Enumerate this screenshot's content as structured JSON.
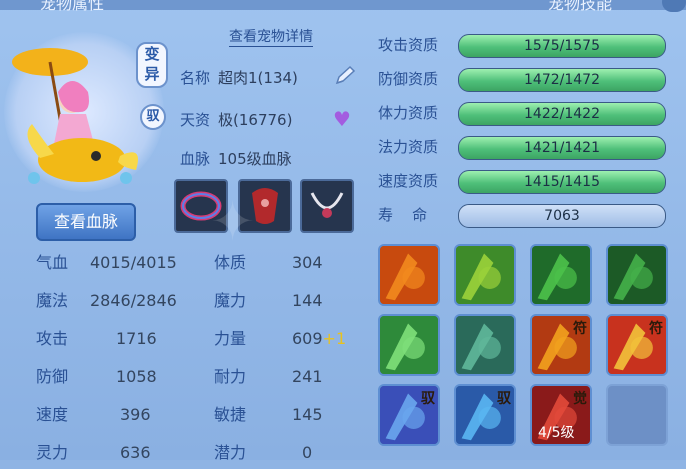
{
  "header": {
    "left_title": "宠物属性",
    "right_title": "宠物技能"
  },
  "pet": {
    "variant_tag": "变异",
    "tame_tag": "驭",
    "blood_button": "查看血脉",
    "detail_link": "查看宠物详情",
    "name_label": "名称",
    "name_value": "超肉1(134)",
    "talent_label": "天资",
    "talent_value": "极(16776)",
    "bloodline_label": "血脉",
    "bloodline_value": "105级血脉"
  },
  "stats": [
    {
      "k": "气血",
      "v": "4015/4015"
    },
    {
      "k": "魔法",
      "v": "2846/2846"
    },
    {
      "k": "攻击",
      "v": "1716"
    },
    {
      "k": "防御",
      "v": "1058"
    },
    {
      "k": "速度",
      "v": "396"
    },
    {
      "k": "灵力",
      "v": "636"
    }
  ],
  "attrs": [
    {
      "k": "体质",
      "v": "304",
      "plus": ""
    },
    {
      "k": "魔力",
      "v": "144",
      "plus": ""
    },
    {
      "k": "力量",
      "v": "609",
      "plus": "+1"
    },
    {
      "k": "耐力",
      "v": "241",
      "plus": ""
    },
    {
      "k": "敏捷",
      "v": "145",
      "plus": ""
    },
    {
      "k": "潜力",
      "v": "0",
      "plus": ""
    }
  ],
  "aptitudes": [
    {
      "k": "攻击资质",
      "v": "1575/1575",
      "fill": 1.0
    },
    {
      "k": "防御资质",
      "v": "1472/1472",
      "fill": 1.0
    },
    {
      "k": "体力资质",
      "v": "1422/1422",
      "fill": 1.0
    },
    {
      "k": "法力资质",
      "v": "1421/1421",
      "fill": 1.0
    },
    {
      "k": "速度资质",
      "v": "1415/1415",
      "fill": 1.0
    }
  ],
  "life": {
    "k": "寿    命",
    "v": "7063"
  },
  "skills": [
    {
      "name": "sword-strike-icon",
      "mark": "",
      "lvl": ""
    },
    {
      "name": "shield-emblem-icon",
      "mark": "",
      "lvl": ""
    },
    {
      "name": "bat-shadow-icon",
      "mark": "",
      "lvl": ""
    },
    {
      "name": "horse-silhouette-icon",
      "mark": "",
      "lvl": ""
    },
    {
      "name": "heart-icon",
      "mark": "",
      "lvl": ""
    },
    {
      "name": "swirl-shield-icon",
      "mark": "",
      "lvl": ""
    },
    {
      "name": "red-warrior-icon",
      "mark": "符",
      "lvl": ""
    },
    {
      "name": "sword-burst-icon",
      "mark": "符",
      "lvl": ""
    },
    {
      "name": "purple-fist-icon",
      "mark": "驭",
      "lvl": ""
    },
    {
      "name": "ice-claw-icon",
      "mark": "驭",
      "lvl": ""
    },
    {
      "name": "awaken-slash-icon",
      "mark": "觉",
      "lvl": "4/5级"
    },
    {
      "name": "empty-skill-slot",
      "mark": "",
      "lvl": ""
    }
  ],
  "colors": {
    "bar_fill": "#4fc07a",
    "label": "#2a5194",
    "panel": "#8ab0e2"
  }
}
